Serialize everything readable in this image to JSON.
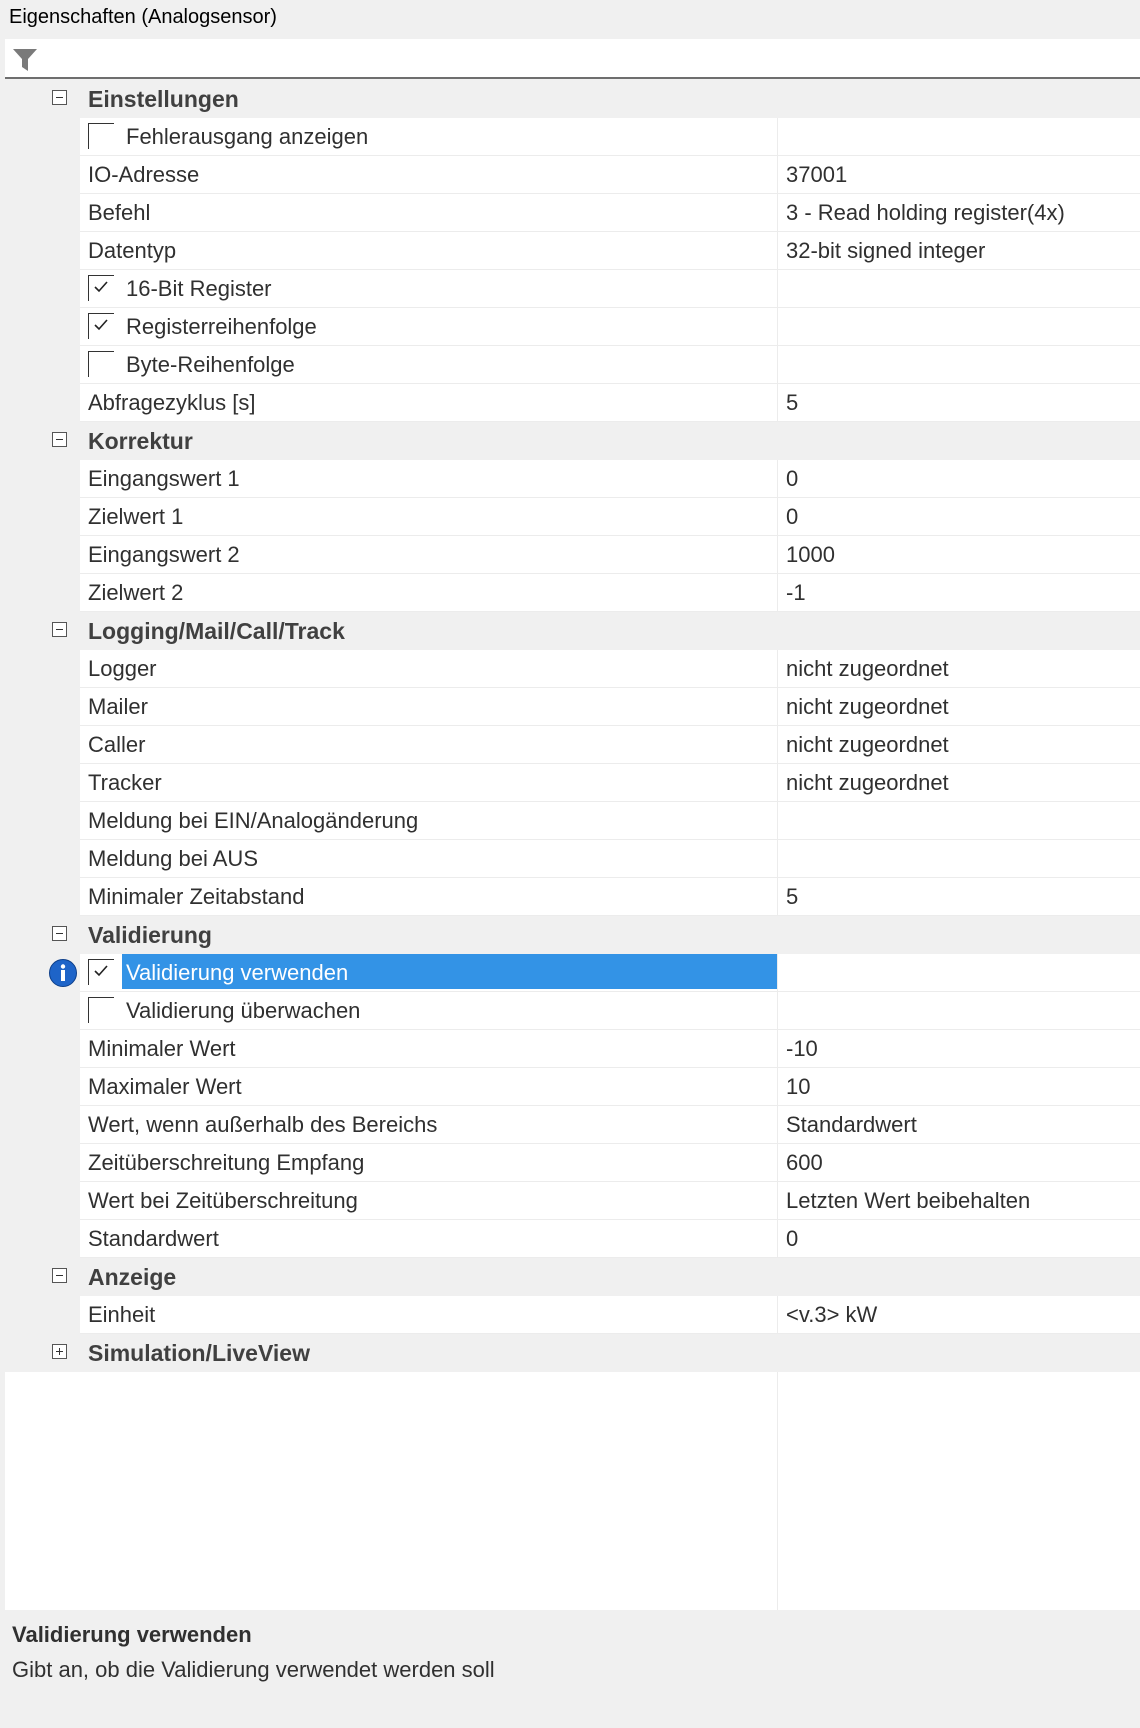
{
  "window": {
    "title": "Eigenschaften (Analogsensor)"
  },
  "filter": {
    "icon": "filter-icon"
  },
  "sections": [
    {
      "label": "Einstellungen",
      "expanded": true,
      "rows": [
        {
          "name": "Fehlerausgang anzeigen",
          "value": "",
          "checkbox": true,
          "checked": false
        },
        {
          "name": "IO-Adresse",
          "value": "37001"
        },
        {
          "name": "Befehl",
          "value": "3 - Read holding register(4x)"
        },
        {
          "name": "Datentyp",
          "value": "32-bit signed integer"
        },
        {
          "name": "16-Bit Register",
          "value": "",
          "checkbox": true,
          "checked": true
        },
        {
          "name": "Registerreihenfolge",
          "value": "",
          "checkbox": true,
          "checked": true
        },
        {
          "name": "Byte-Reihenfolge",
          "value": "",
          "checkbox": true,
          "checked": false
        },
        {
          "name": "Abfragezyklus [s]",
          "value": "5"
        }
      ]
    },
    {
      "label": "Korrektur",
      "expanded": true,
      "rows": [
        {
          "name": "Eingangswert 1",
          "value": "0"
        },
        {
          "name": "Zielwert 1",
          "value": "0"
        },
        {
          "name": "Eingangswert 2",
          "value": "1000"
        },
        {
          "name": "Zielwert 2",
          "value": "-1"
        }
      ]
    },
    {
      "label": "Logging/Mail/Call/Track",
      "expanded": true,
      "rows": [
        {
          "name": "Logger",
          "value": "nicht zugeordnet"
        },
        {
          "name": "Mailer",
          "value": "nicht zugeordnet"
        },
        {
          "name": "Caller",
          "value": "nicht zugeordnet"
        },
        {
          "name": "Tracker",
          "value": "nicht zugeordnet"
        },
        {
          "name": "Meldung bei EIN/Analogänderung",
          "value": ""
        },
        {
          "name": "Meldung bei AUS",
          "value": ""
        },
        {
          "name": "Minimaler Zeitabstand",
          "value": "5"
        }
      ]
    },
    {
      "label": "Validierung",
      "expanded": true,
      "rows": [
        {
          "name": "Validierung verwenden",
          "value": "",
          "checkbox": true,
          "checked": true,
          "selected": true,
          "info": true
        },
        {
          "name": "Validierung überwachen",
          "value": "",
          "checkbox": true,
          "checked": false
        },
        {
          "name": "Minimaler Wert",
          "value": "-10"
        },
        {
          "name": "Maximaler Wert",
          "value": "10"
        },
        {
          "name": "Wert, wenn außerhalb des Bereichs",
          "value": "Standardwert"
        },
        {
          "name": "Zeitüberschreitung Empfang",
          "value": "600"
        },
        {
          "name": "Wert bei Zeitüberschreitung",
          "value": "Letzten Wert beibehalten"
        },
        {
          "name": "Standardwert",
          "value": "0"
        }
      ]
    },
    {
      "label": "Anzeige",
      "expanded": true,
      "rows": [
        {
          "name": "Einheit",
          "value": "<v.3> kW"
        }
      ]
    },
    {
      "label": "Simulation/LiveView",
      "expanded": false,
      "rows": []
    }
  ],
  "help": {
    "title": "Validierung verwenden",
    "description": "Gibt an, ob die Validierung verwendet werden soll"
  },
  "colors": {
    "selection": "#3393e6",
    "info_icon": "#1e64c8",
    "category_bg": "#f0f0f0"
  }
}
